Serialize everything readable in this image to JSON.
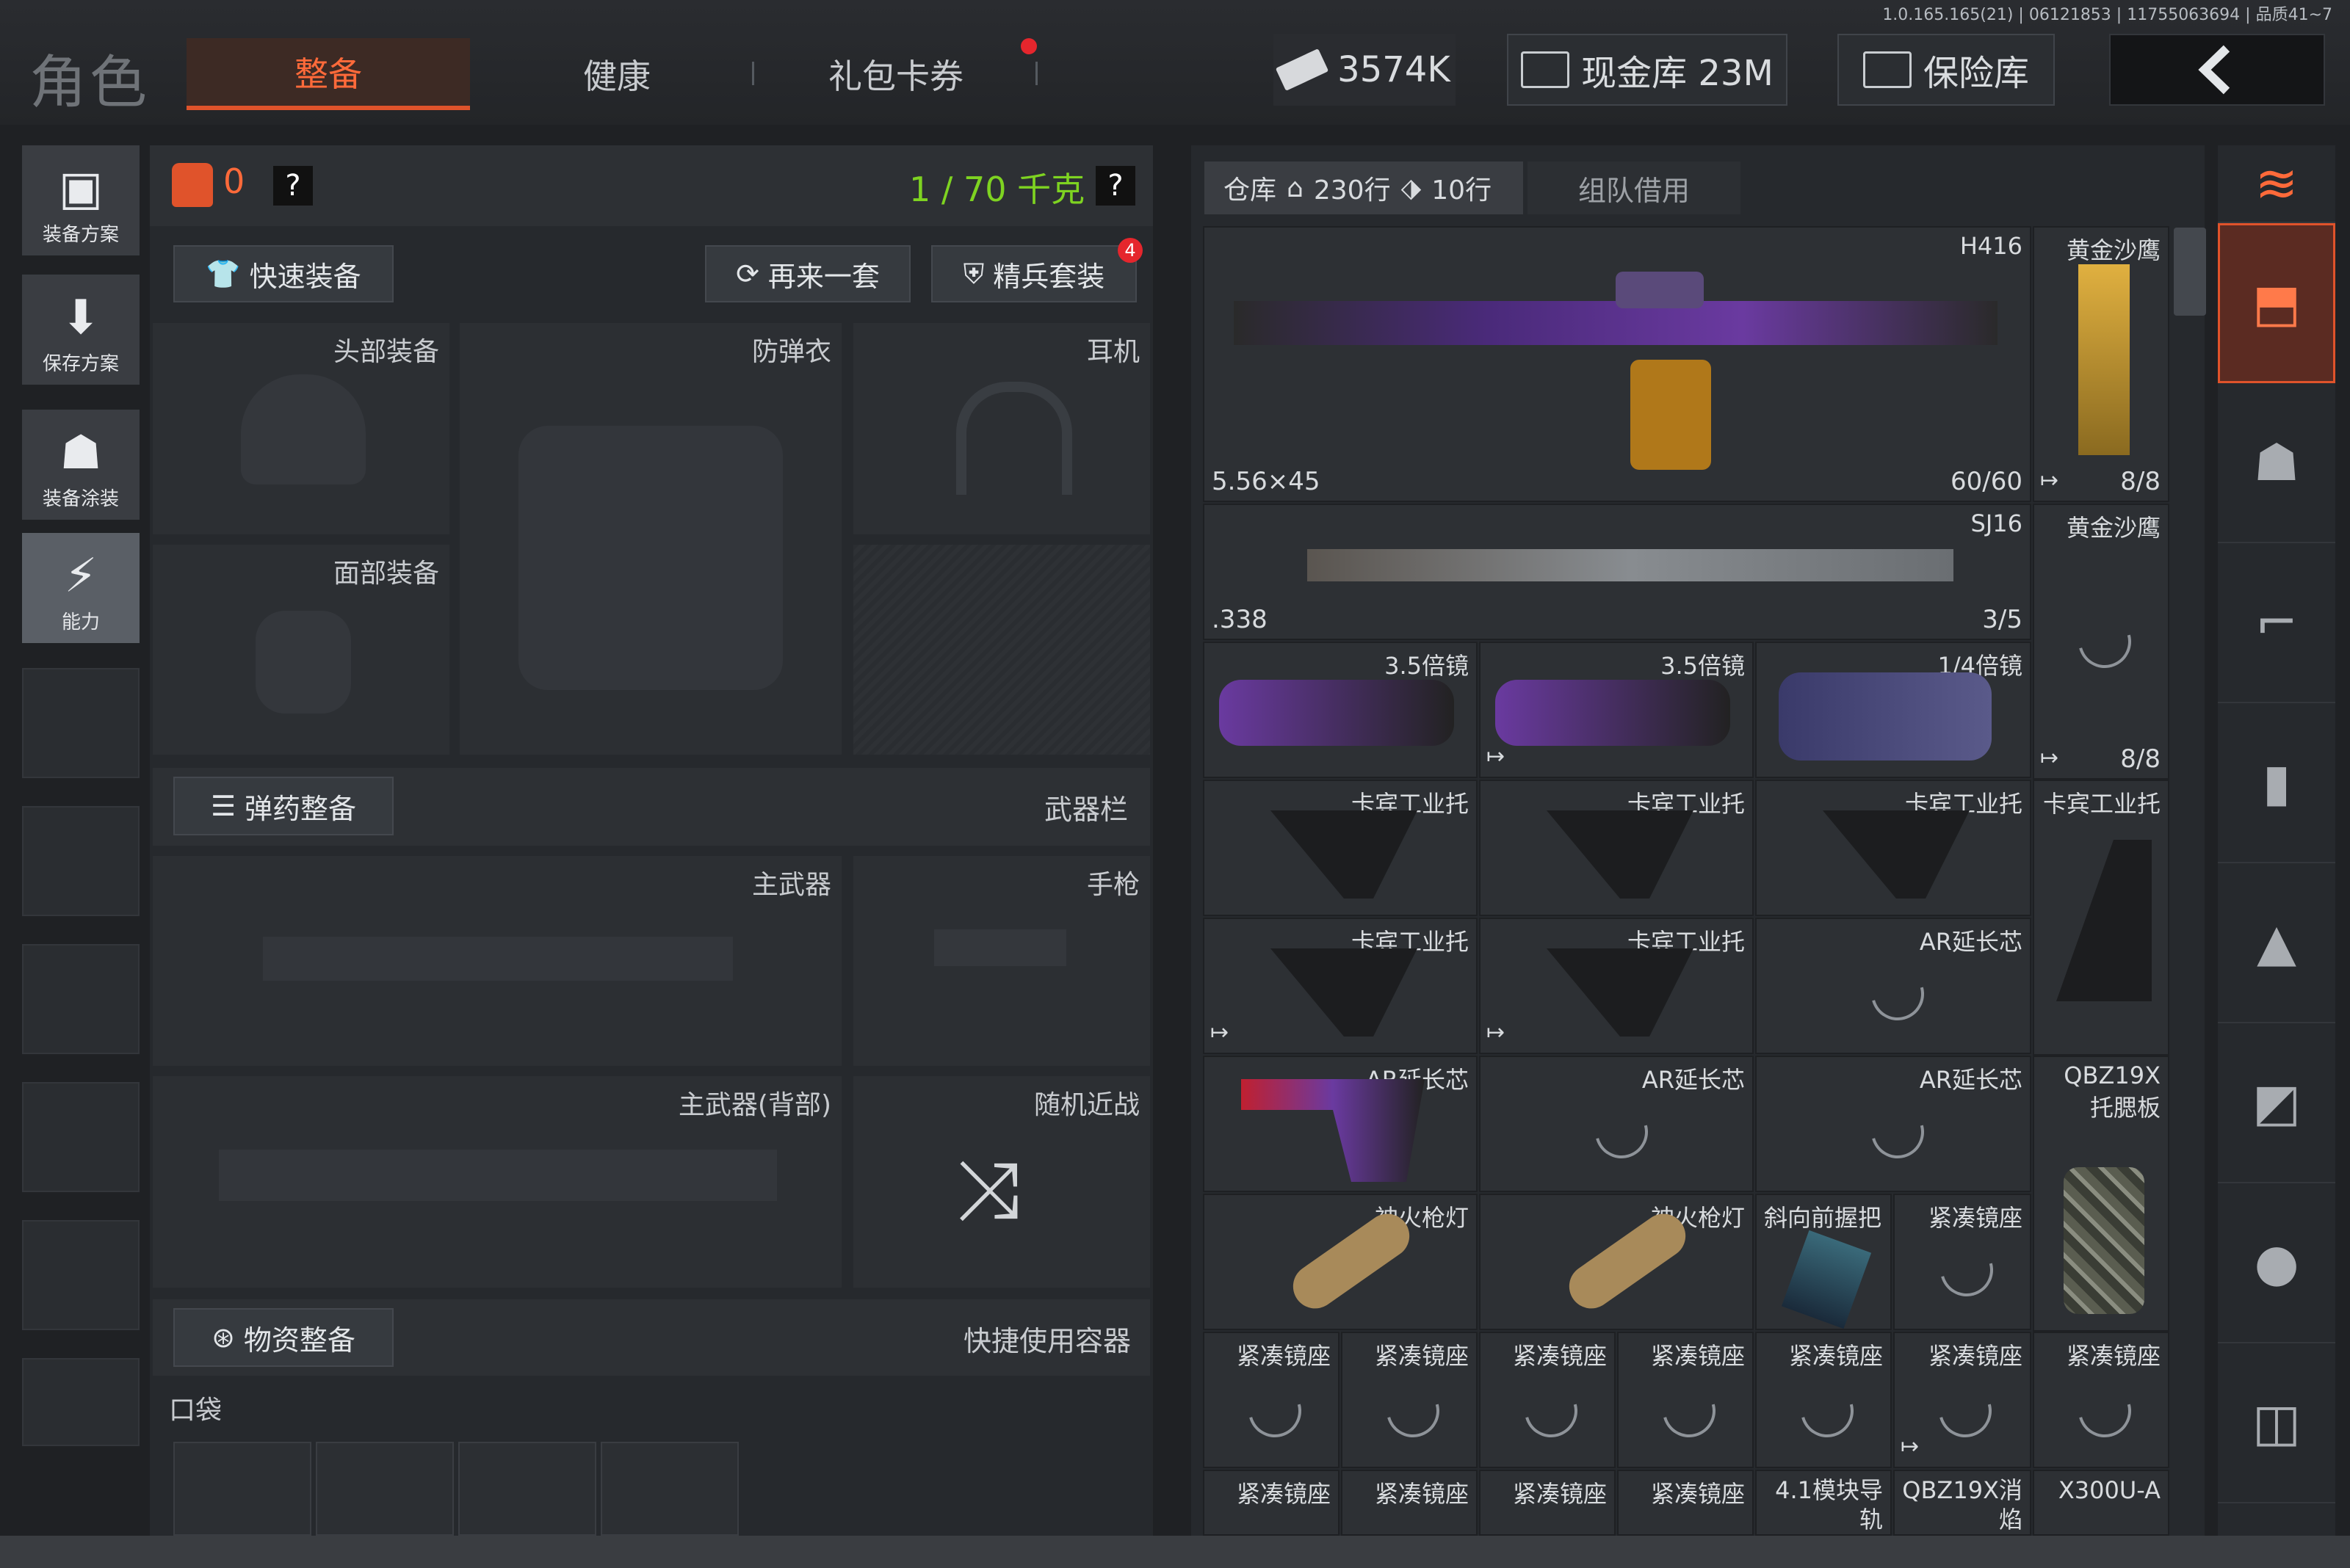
{
  "version": "1.0.165.165(21) | 06121853 | 11755063694 | 品质41~7",
  "header": {
    "section_title": "角色",
    "tabs": [
      {
        "label": "整备",
        "active": true
      },
      {
        "label": "健康"
      },
      {
        "label": "礼包卡券"
      }
    ],
    "currency": "3574K",
    "cash_vault": "现金库 23M",
    "safe": "保险库"
  },
  "left_menu": [
    {
      "label": "装备方案",
      "icon": "vest-icon"
    },
    {
      "label": "保存方案",
      "icon": "download-icon"
    },
    {
      "label": "装备涂装",
      "icon": "helmet-paint-icon"
    },
    {
      "label": "能力",
      "icon": "lightning-icon",
      "active": true
    }
  ],
  "loadout": {
    "backpack_count": "0",
    "weight": "1 / 70 千克",
    "quick_equip": "快速装备",
    "another_set": "再来一套",
    "elite_set": "精兵套装",
    "elite_badge": "4",
    "slots": {
      "head": "头部装备",
      "armor": "防弹衣",
      "headset": "耳机",
      "face": "面部装备",
      "ammo_btn": "弹药整备",
      "weapon_bar": "武器栏",
      "primary": "主武器",
      "pistol": "手枪",
      "primary_back": "主武器(背部)",
      "melee": "随机近战",
      "supply_btn": "物资整备",
      "quick_container": "快捷使用容器",
      "pocket": "口袋"
    }
  },
  "warehouse": {
    "tab_label": "仓库",
    "rows_home": "230行",
    "rows_tag": "10行",
    "team_borrow": "组队借用",
    "items": [
      {
        "name": "H416",
        "caliber": "5.56×45",
        "ammo": "60/60"
      },
      {
        "name": "黄金沙鹰",
        "ammo": "8/8"
      },
      {
        "name": "SJ16",
        "caliber": ".338",
        "ammo": "3/5"
      },
      {
        "name": "黄金沙鹰",
        "ammo": "8/8"
      },
      {
        "name": "3.5倍镜"
      },
      {
        "name": "3.5倍镜"
      },
      {
        "name": "1/4倍镜"
      },
      {
        "name": "卡宾工业托"
      },
      {
        "name": "卡宾工业托"
      },
      {
        "name": "卡宾工业托"
      },
      {
        "name": "卡宾工业托"
      },
      {
        "name": "卡宾工业托"
      },
      {
        "name": "卡宾工业托"
      },
      {
        "name": "AR延长芯"
      },
      {
        "name": "AR延长芯"
      },
      {
        "name": "AR延长芯"
      },
      {
        "name": "AR延长芯"
      },
      {
        "name": "QBZ19X托腮板"
      },
      {
        "name": "神火枪灯"
      },
      {
        "name": "神火枪灯"
      },
      {
        "name": "斜向前握把"
      },
      {
        "name": "紧凑镜座"
      },
      {
        "name": "紧凑镜座"
      },
      {
        "name": "4.1模块导轨"
      },
      {
        "name": "QBZ19X消焰"
      },
      {
        "name": "X300U-A"
      }
    ]
  },
  "colors": {
    "accent": "#e0532b",
    "weight_green": "#7ed321",
    "highlight_orange": "#ff6a3a"
  }
}
